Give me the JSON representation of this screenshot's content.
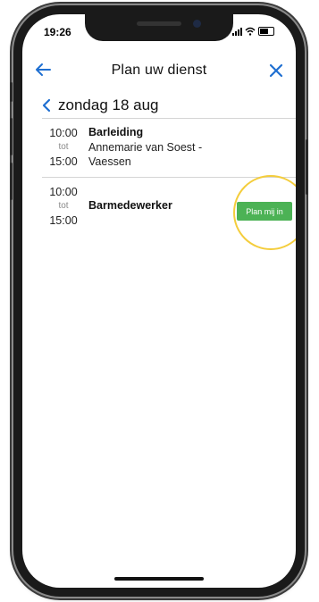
{
  "status": {
    "time": "19:26"
  },
  "header": {
    "title": "Plan uw dienst"
  },
  "date": {
    "label": "zondag 18 aug"
  },
  "shifts": [
    {
      "start": "10:00",
      "sep": "tot",
      "end": "15:00",
      "role": "Barleiding",
      "person_line1": "Annemarie van Soest -",
      "person_line2": "Vaessen"
    },
    {
      "start": "10:00",
      "sep": "tot",
      "end": "15:00",
      "role": "Barmedewerker",
      "action": "Plan mij in"
    }
  ],
  "colors": {
    "accent": "#1f6fd1",
    "button": "#4cb255",
    "highlight": "#f4cd3c"
  }
}
